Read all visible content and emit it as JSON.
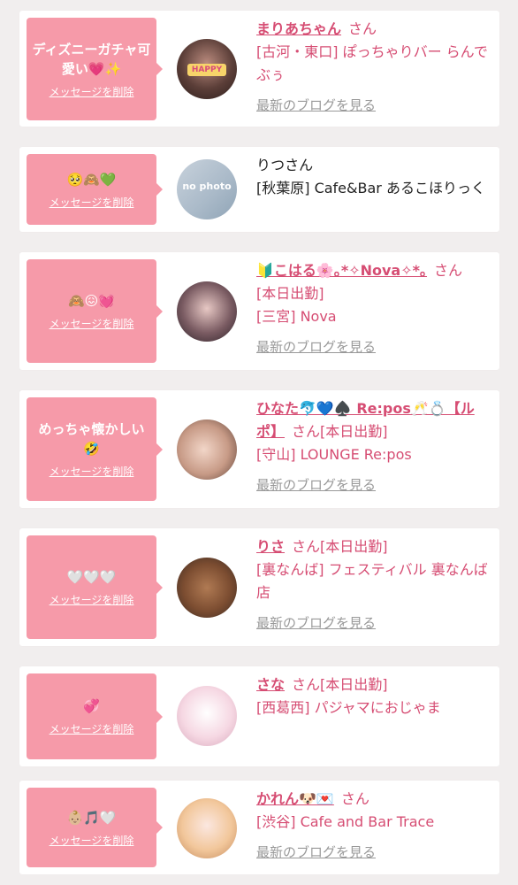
{
  "labels": {
    "delete": "メッセージを削除",
    "latest_blog": "最新のブログを見る",
    "san": "さん"
  },
  "entries": [
    {
      "message": "ディズニーガチャ可愛い💗✨",
      "avatar_text": "HAPPY",
      "name": "まりあちゃん",
      "line1": "[古河・東口] ぽっちゃりバー らんでぶぅ",
      "line2": ""
    },
    {
      "message": "🥺🙈💚",
      "avatar_text": "no photo",
      "name": "りつさん",
      "line1": "[秋葉原] Cafe&Bar あるこほりっく",
      "line2": ""
    },
    {
      "message": "🙈😖💓",
      "avatar_text": "",
      "name": "🔰こはる🌸｡*✧Nova✧*｡",
      "line1": "[本日出勤]",
      "line2": "[三宮] Nova"
    },
    {
      "message": "めっちゃ懐かしい🤣",
      "avatar_text": "",
      "name": "ひなた🐬💙♠️ Re:pos🥂💍【ルポ】",
      "line1": "[本日出勤]",
      "line2": "[守山] LOUNGE Re:pos"
    },
    {
      "message": "🤍🤍🤍",
      "avatar_text": "",
      "name": "りさ",
      "line1": "[本日出勤]",
      "line2": "[裏なんば] フェスティバル 裏なんば店"
    },
    {
      "message": "💞",
      "avatar_text": "",
      "name": "さな",
      "line1": "[本日出勤]",
      "line2": "[西葛西] パジャマにおじゃま"
    },
    {
      "message": "👶🏼🎵🤍",
      "avatar_text": "",
      "name": "かれん🐶💌",
      "line1": "[渋谷] Cafe and Bar Trace",
      "line2": ""
    }
  ]
}
